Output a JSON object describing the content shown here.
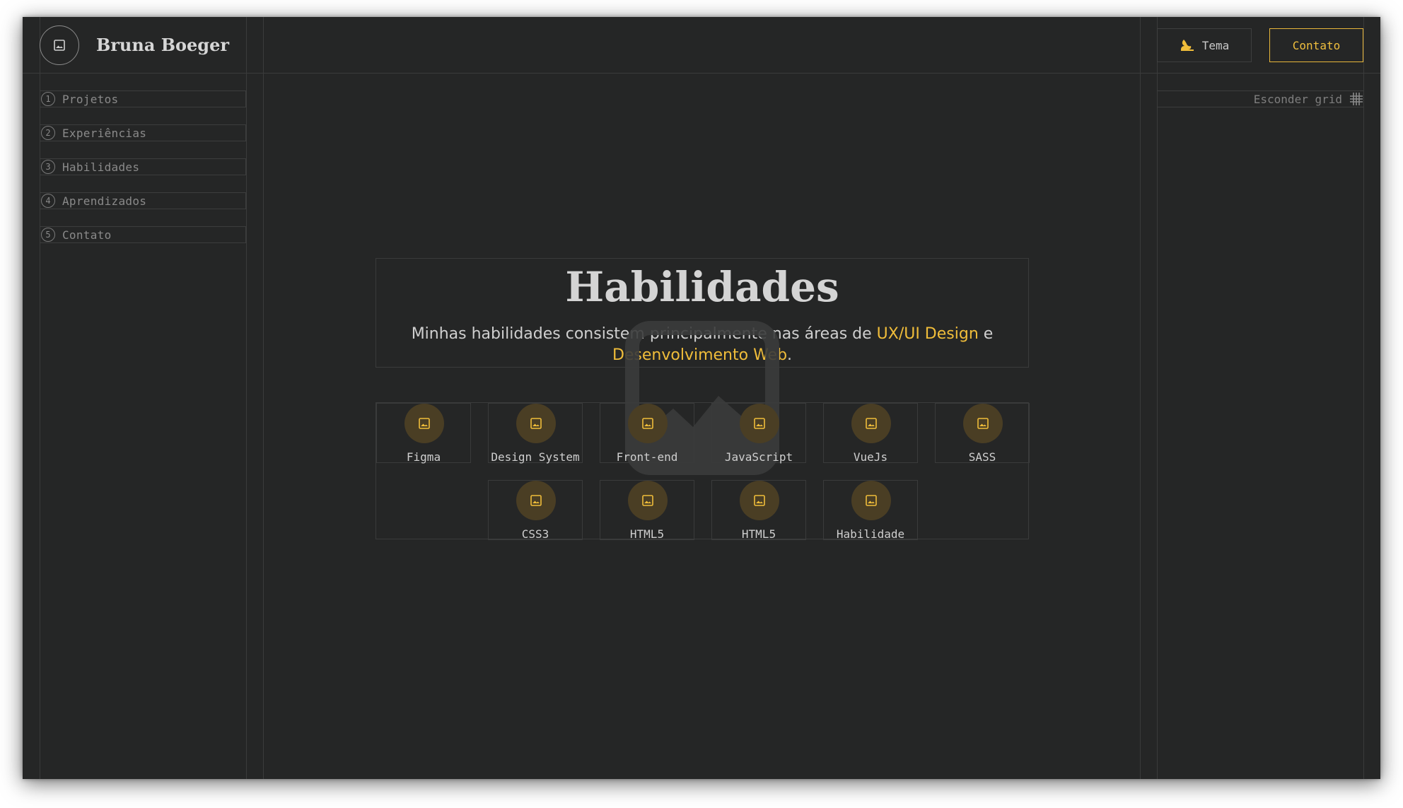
{
  "header": {
    "brand_name": "Bruna Boeger",
    "theme_label": "Tema",
    "contact_label": "Contato",
    "grid_toggle_label": "Esconder grid"
  },
  "nav": {
    "items": [
      {
        "number": "1",
        "label": "Projetos"
      },
      {
        "number": "2",
        "label": "Experiências"
      },
      {
        "number": "3",
        "label": "Habilidades"
      },
      {
        "number": "4",
        "label": "Aprendizados"
      },
      {
        "number": "5",
        "label": "Contato"
      }
    ]
  },
  "hero": {
    "title": "Habilidades",
    "desc_prefix": "Minhas habilidades consistem principalmente nas áreas de ",
    "desc_highlight_1": "UX/UI Design",
    "desc_middle": " e ",
    "desc_highlight_2": "Desenvolvimento Web",
    "desc_suffix": "."
  },
  "skills": [
    {
      "label": "Figma"
    },
    {
      "label": "Design System"
    },
    {
      "label": "Front-end"
    },
    {
      "label": "JavaScript"
    },
    {
      "label": "VueJs"
    },
    {
      "label": "SASS"
    },
    {
      "label": "CSS3"
    },
    {
      "label": "HTML5"
    },
    {
      "label": "HTML5"
    },
    {
      "label": "Habilidade"
    }
  ],
  "colors": {
    "background": "#252626",
    "accent": "#f0bd3a",
    "text": "#d4d4d4",
    "muted": "#8a8a8a",
    "grid_line": "#3a3b3b"
  },
  "icons": {
    "brand": "image-placeholder-icon",
    "theme": "theme-icon",
    "grid": "grid-icon",
    "skill": "image-placeholder-icon"
  }
}
